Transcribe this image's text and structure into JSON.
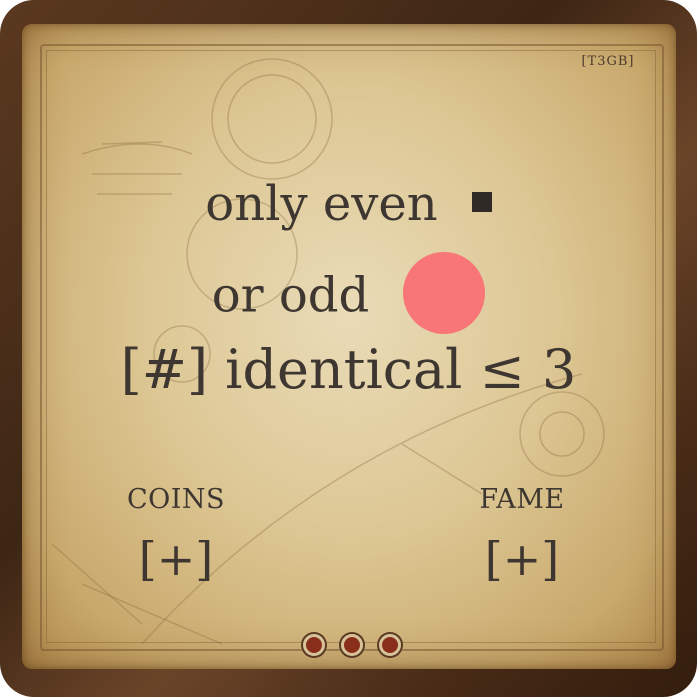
{
  "card": {
    "code": "[T3GB]",
    "condition": {
      "line1_text": "only  even",
      "line1_icon": "square-icon",
      "line2_text": "or  odd",
      "line2_icon": "circle-icon",
      "line2_icon_color": "#f87678",
      "line3_text": "[#]  identical  ≤  3"
    },
    "rewards": {
      "coins_label": "COINS",
      "coins_value": "[+]",
      "fame_label": "FAME",
      "fame_value": "[+]"
    },
    "pager": {
      "count": 3
    }
  }
}
